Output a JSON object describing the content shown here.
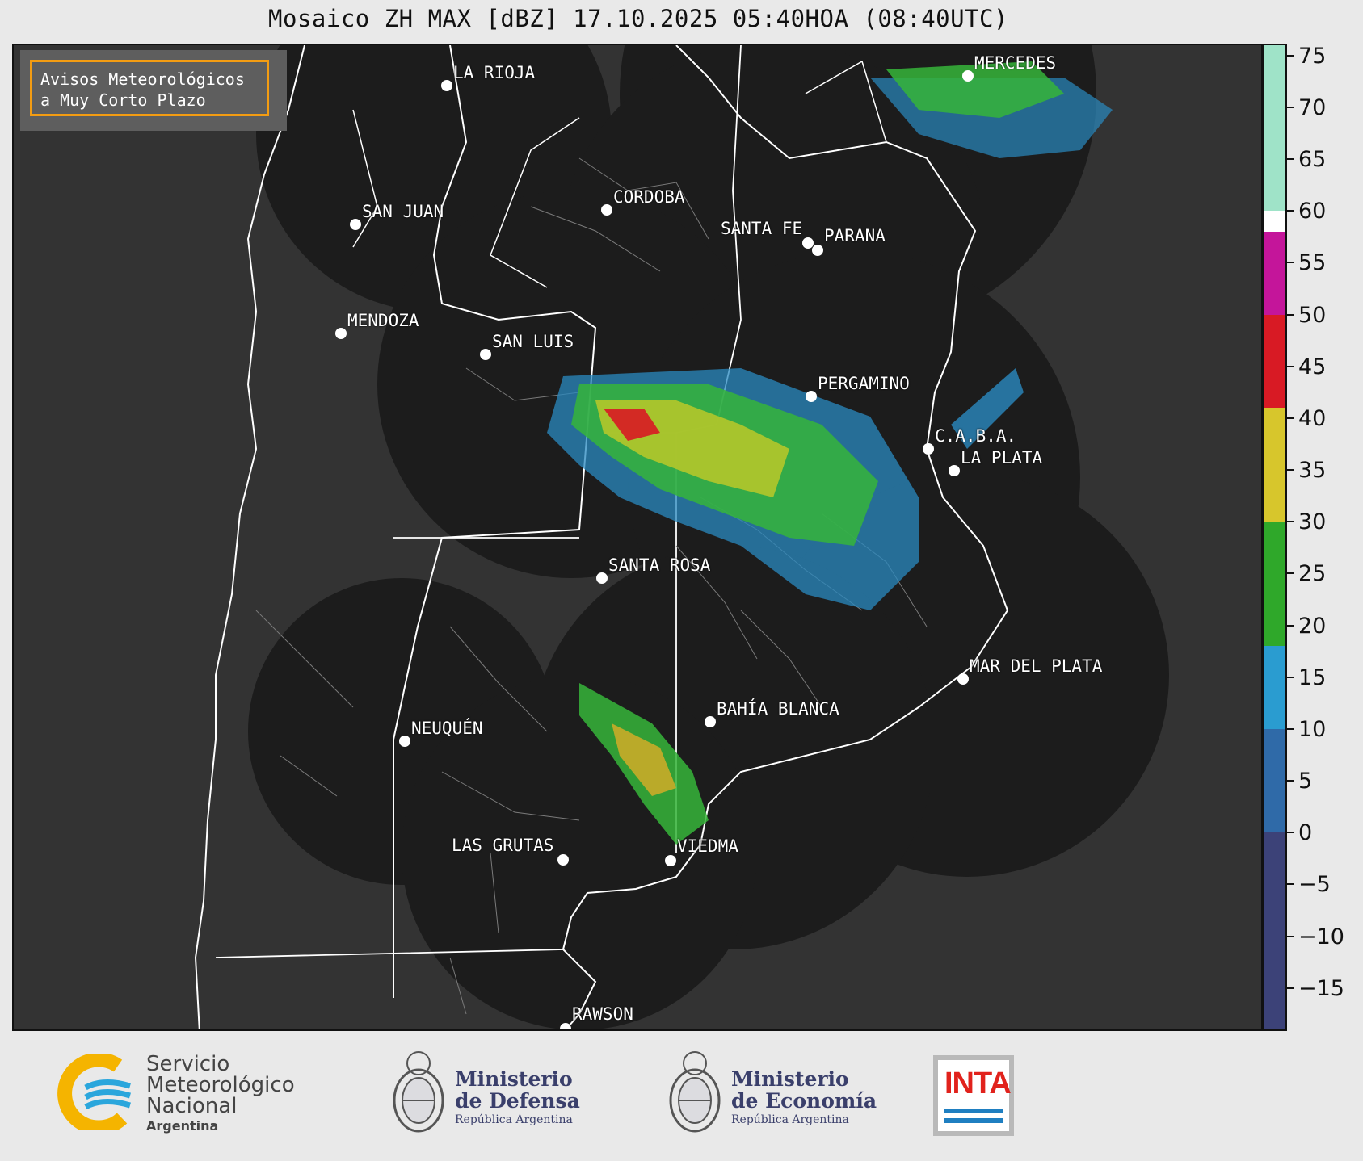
{
  "title": "Mosaico ZH MAX [dBZ] 17.10.2025 05:40HOA (08:40UTC)",
  "notice": {
    "line1": "Avisos Meteorológicos",
    "line2": "a Muy Corto Plazo",
    "border_color": "#f39c12"
  },
  "cities": [
    {
      "id": "la-rioja",
      "name": "LA RIOJA"
    },
    {
      "id": "mercedes",
      "name": "MERCEDES"
    },
    {
      "id": "cordoba",
      "name": "CORDOBA"
    },
    {
      "id": "san-juan",
      "name": "SAN JUAN"
    },
    {
      "id": "santa-fe",
      "name": "SANTA FE"
    },
    {
      "id": "parana",
      "name": "PARANA"
    },
    {
      "id": "mendoza",
      "name": "MENDOZA"
    },
    {
      "id": "san-luis",
      "name": "SAN LUIS"
    },
    {
      "id": "pergamino",
      "name": "PERGAMINO"
    },
    {
      "id": "caba",
      "name": "C.A.B.A."
    },
    {
      "id": "la-plata",
      "name": "LA PLATA"
    },
    {
      "id": "santa-rosa",
      "name": "SANTA ROSA"
    },
    {
      "id": "mar-del-plata",
      "name": "MAR DEL PLATA"
    },
    {
      "id": "bahia-blanca",
      "name": "BAHÍA BLANCA"
    },
    {
      "id": "neuquen",
      "name": "NEUQUÉN"
    },
    {
      "id": "las-grutas",
      "name": "LAS GRUTAS"
    },
    {
      "id": "viedma",
      "name": "VIEDMA"
    },
    {
      "id": "rawson",
      "name": "RAWSON"
    }
  ],
  "colorbar": {
    "unit": "dBZ",
    "min": -19,
    "max": 76,
    "ticks": [
      "75",
      "70",
      "65",
      "60",
      "55",
      "50",
      "45",
      "40",
      "35",
      "30",
      "25",
      "20",
      "15",
      "10",
      "5",
      "0",
      "−5",
      "−10",
      "−15"
    ],
    "stops": [
      {
        "from": -19,
        "to": 0,
        "color": "#3c4278"
      },
      {
        "from": 0,
        "to": 10,
        "color": "#2f6aa8"
      },
      {
        "from": 10,
        "to": 18,
        "color": "#2a9cd0"
      },
      {
        "from": 18,
        "to": 30,
        "color": "#2fa82a"
      },
      {
        "from": 30,
        "to": 41,
        "color": "#d7c62c"
      },
      {
        "from": 41,
        "to": 50,
        "color": "#d81a24"
      },
      {
        "from": 50,
        "to": 58,
        "color": "#c4159a"
      },
      {
        "from": 58,
        "to": 60,
        "color": "#ffffff"
      },
      {
        "from": 60,
        "to": 76,
        "color": "#9fe3c8"
      }
    ]
  },
  "footer": {
    "smn": {
      "line1": "Servicio",
      "line2": "Meteorológico",
      "line3": "Nacional",
      "line4": "Argentina"
    },
    "defensa": {
      "line1": "Ministerio",
      "line2": "de Defensa",
      "line3": "República Argentina"
    },
    "economia": {
      "line1": "Ministerio",
      "line2": "de Economía",
      "line3": "República Argentina"
    },
    "inta": {
      "word": "INTA"
    }
  }
}
